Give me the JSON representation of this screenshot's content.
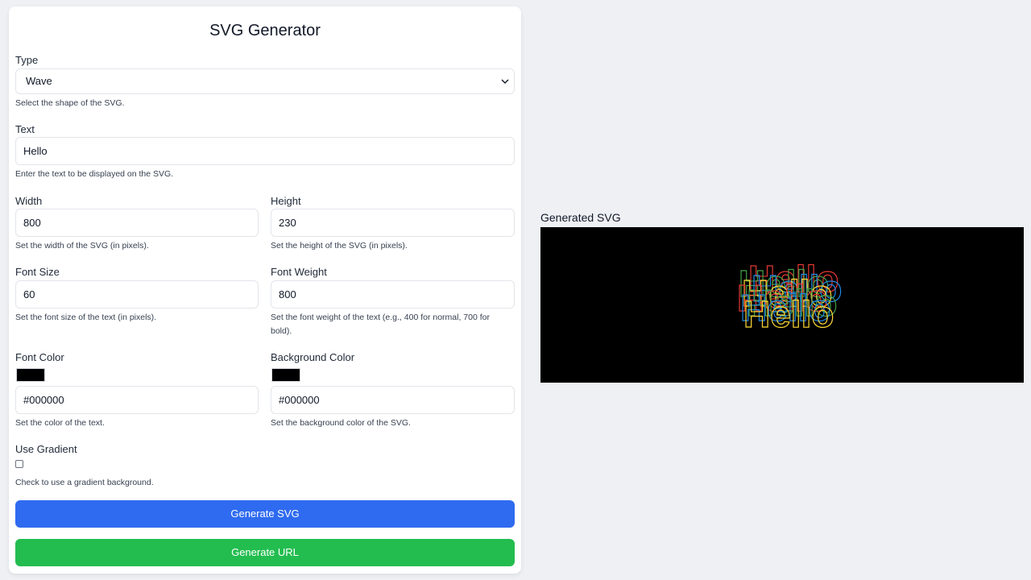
{
  "app": {
    "title": "SVG Generator"
  },
  "form": {
    "type": {
      "label": "Type",
      "value": "Wave",
      "help": "Select the shape of the SVG."
    },
    "text": {
      "label": "Text",
      "value": "Hello",
      "help": "Enter the text to be displayed on the SVG."
    },
    "width": {
      "label": "Width",
      "value": "800",
      "help": "Set the width of the SVG (in pixels)."
    },
    "height": {
      "label": "Height",
      "value": "230",
      "help": "Set the height of the SVG (in pixels)."
    },
    "font_size": {
      "label": "Font Size",
      "value": "60",
      "help": "Set the font size of the text (in pixels)."
    },
    "font_weight": {
      "label": "Font Weight",
      "value": "800",
      "help": "Set the font weight of the text (e.g., 400 for normal, 700 for bold)."
    },
    "font_color": {
      "label": "Font Color",
      "value": "#000000",
      "help": "Set the color of the text."
    },
    "background_color": {
      "label": "Background Color",
      "value": "#000000",
      "help": "Set the background color of the SVG."
    },
    "use_gradient": {
      "label": "Use Gradient",
      "checked": false,
      "help": "Check to use a gradient background."
    }
  },
  "buttons": {
    "generate_svg": "Generate SVG",
    "generate_url": "Generate URL"
  },
  "preview": {
    "label": "Generated SVG",
    "text": "Hello",
    "background": "#000000",
    "stroke_colors": [
      "#e53935",
      "#43a047",
      "#1e88e5",
      "#fdd835"
    ]
  },
  "colors": {
    "primary_button": "#2f6bf0",
    "success_button": "#23bd4f",
    "page_background": "#eef0f4"
  },
  "icons": {
    "select_chevron": "chevron-down-icon"
  }
}
